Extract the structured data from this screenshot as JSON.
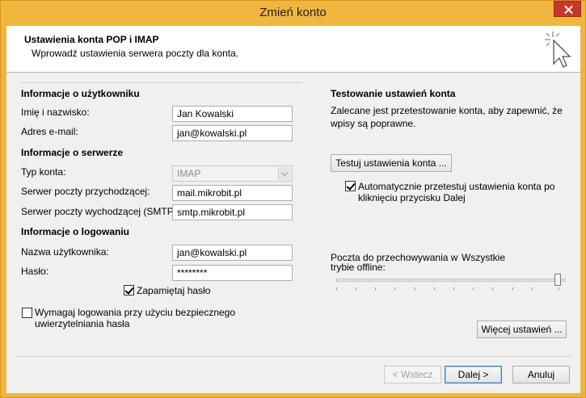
{
  "window": {
    "title": "Zmień konto"
  },
  "header": {
    "title": "Ustawienia konta POP i IMAP",
    "subtitle": "Wprowadź ustawienia serwera poczty dla konta."
  },
  "user_info": {
    "heading": "Informacje o użytkowniku",
    "name_label": "Imię i nazwisko:",
    "name_value": "Jan Kowalski",
    "email_label": "Adres e-mail:",
    "email_value": "jan@kowalski.pl"
  },
  "server_info": {
    "heading": "Informacje o serwerze",
    "account_type_label": "Typ konta:",
    "account_type_value": "IMAP",
    "incoming_label": "Serwer poczty przychodzącej:",
    "incoming_value": "mail.mikrobit.pl",
    "outgoing_label": "Serwer poczty wychodzącej (SMTP):",
    "outgoing_value": "smtp.mikrobit.pl"
  },
  "login_info": {
    "heading": "Informacje o logowaniu",
    "username_label": "Nazwa użytkownika:",
    "username_value": "jan@kowalski.pl",
    "password_label": "Hasło:",
    "password_value": "********",
    "remember_label": "Zapamiętaj hasło",
    "remember_checked": true,
    "spa_label_line1": "Wymagaj logowania przy użyciu bezpiecznego",
    "spa_label_line2": "uwierzytelniania hasła",
    "spa_checked": false
  },
  "test_section": {
    "heading": "Testowanie ustawień konta",
    "desc_line1": "Zalecane jest przetestowanie konta, aby zapewnić, że",
    "desc_line2": "wpisy są poprawne.",
    "test_button": "Testuj ustawienia konta ...",
    "auto_test_line1": "Automatycznie przetestuj ustawienia konta po",
    "auto_test_line2": "kliknięciu przycisku Dalej",
    "auto_test_checked": true
  },
  "offline": {
    "label_line1": "Poczta do przechowywania w",
    "label_line2": "trybie offline:",
    "value": "Wszystkie",
    "slider_level": 1.0
  },
  "buttons": {
    "more_settings": "Więcej ustawień ...",
    "back": "< Wstecz",
    "next": "Dalej >",
    "cancel": "Anuluj"
  },
  "colors": {
    "title_bar": "#f0b53f",
    "close_button": "#c7382b",
    "default_button_border": "#3c7fb1"
  }
}
